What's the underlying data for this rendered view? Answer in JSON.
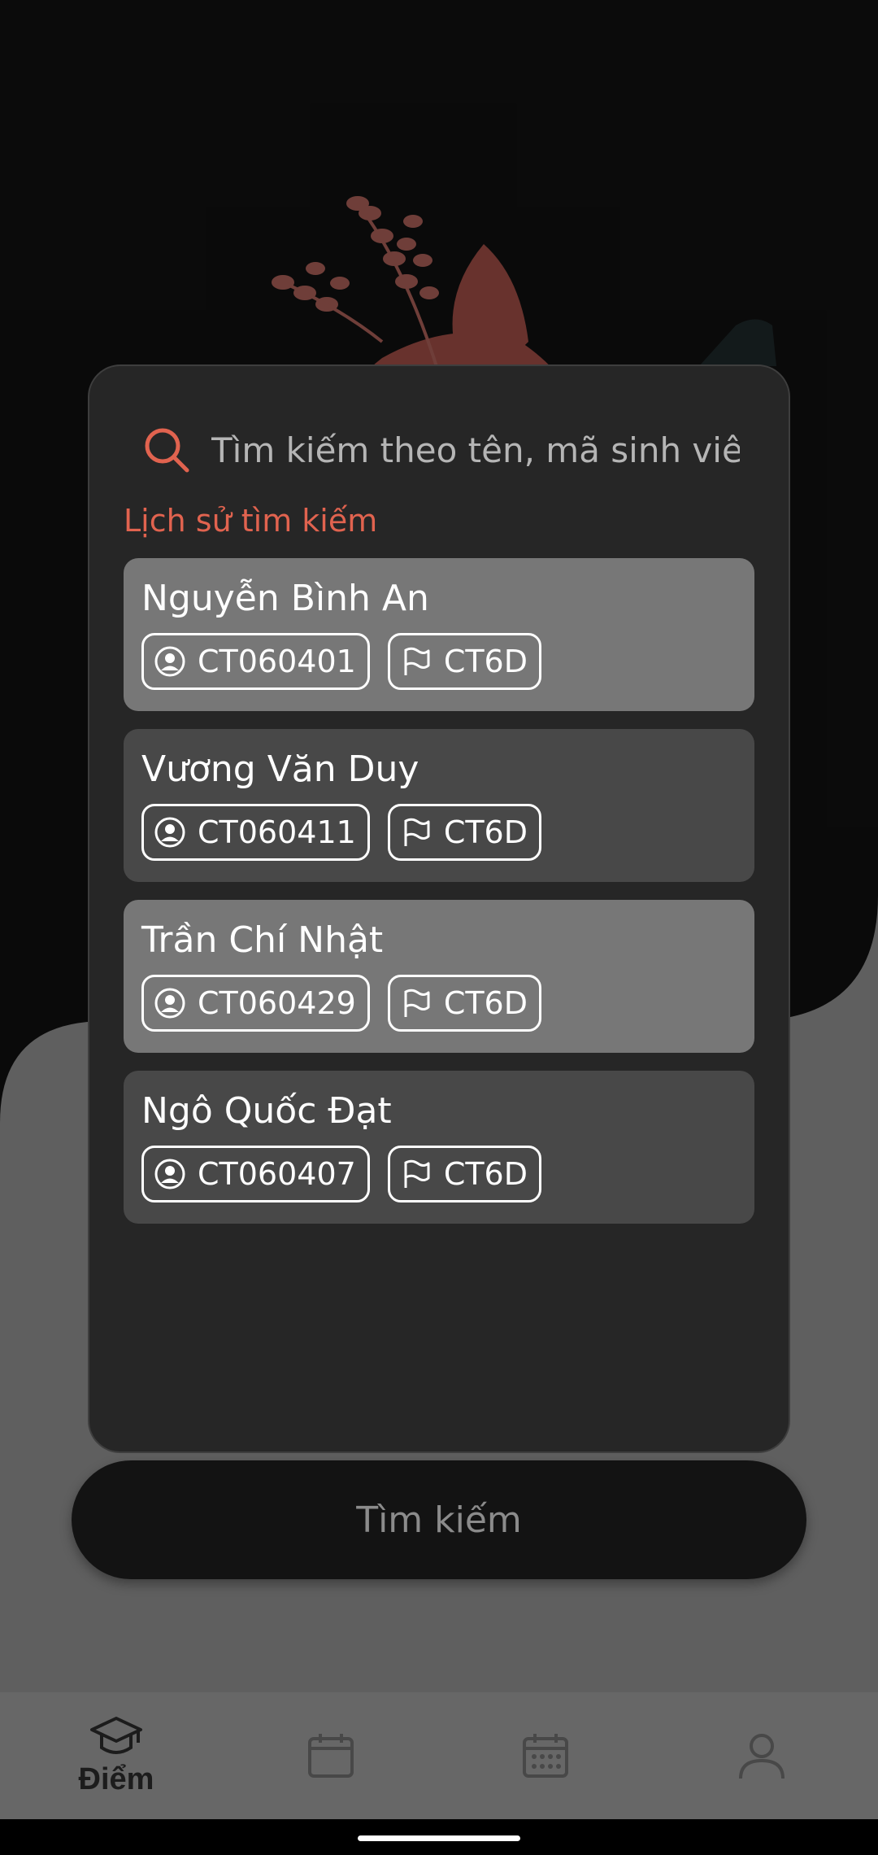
{
  "behind": {
    "title_lines": [
      "",
      ""
    ],
    "subtitle_lines": [
      "",
      ""
    ],
    "search_button_label": "Tìm kiếm"
  },
  "search": {
    "placeholder": "Tìm kiếm theo tên, mã sinh viên",
    "value": ""
  },
  "history_label": "Lịch sử tìm kiếm",
  "history": [
    {
      "name": "Nguyễn Bình An",
      "student_id": "CT060401",
      "class": "CT6D",
      "shade": "light"
    },
    {
      "name": "Vương Văn Duy",
      "student_id": "CT060411",
      "class": "CT6D",
      "shade": "dark"
    },
    {
      "name": "Trần Chí Nhật",
      "student_id": "CT060429",
      "class": "CT6D",
      "shade": "light"
    },
    {
      "name": "Ngô Quốc Đạt",
      "student_id": "CT060407",
      "class": "CT6D",
      "shade": "dark"
    }
  ],
  "bottom_nav": {
    "items": [
      {
        "label": "Điểm",
        "icon": "graduation-cap-icon",
        "active": true
      },
      {
        "label": "",
        "icon": "calendar-blank-icon",
        "active": false
      },
      {
        "label": "",
        "icon": "calendar-grid-icon",
        "active": false
      },
      {
        "label": "",
        "icon": "user-icon",
        "active": false
      }
    ]
  },
  "colors": {
    "accent": "#e1634f",
    "dialog_bg": "#262626",
    "card_light": "#777777",
    "card_dark": "#484848"
  }
}
